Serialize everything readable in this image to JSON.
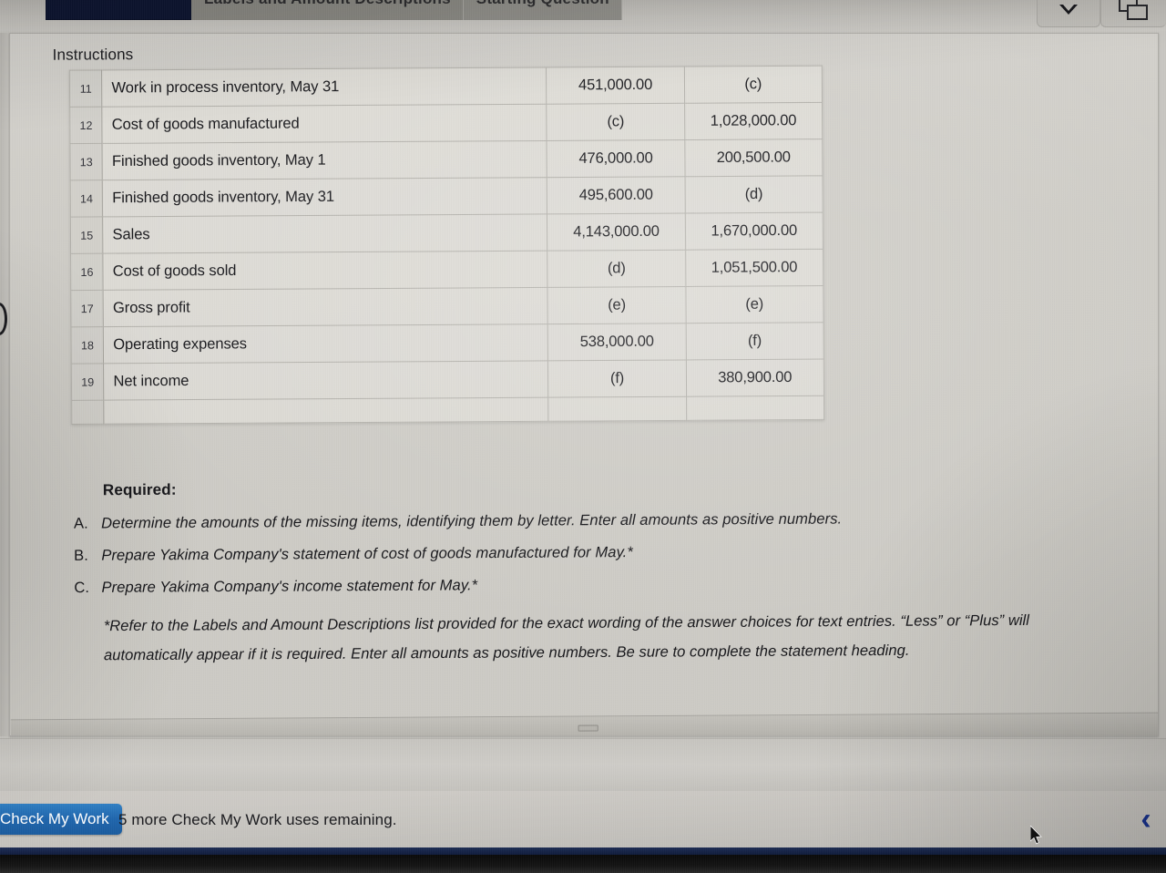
{
  "window": {
    "tabs": [
      {
        "label": "",
        "state": "active",
        "name": "tab-active-dark"
      },
      {
        "label": "Labels and Amount Descriptions",
        "state": "inactive",
        "name": "tab-labels-amount-descriptions"
      },
      {
        "label": "Starting Question",
        "state": "inactive",
        "name": "tab-starting-question"
      }
    ],
    "chrome_buttons": [
      {
        "icon": "chevron-down-icon",
        "label": ""
      },
      {
        "icon": "panes-icon",
        "label": ""
      }
    ]
  },
  "panel": {
    "section_label": "Instructions"
  },
  "sheet": {
    "rows": [
      {
        "num": "11",
        "label": "Work in process inventory, May 31",
        "col1": "451,000.00",
        "col2": "(c)"
      },
      {
        "num": "12",
        "label": "Cost of goods manufactured",
        "col1": "(c)",
        "col2": "1,028,000.00"
      },
      {
        "num": "13",
        "label": "Finished goods inventory, May 1",
        "col1": "476,000.00",
        "col2": "200,500.00"
      },
      {
        "num": "14",
        "label": "Finished goods inventory, May 31",
        "col1": "495,600.00",
        "col2": "(d)"
      },
      {
        "num": "15",
        "label": "Sales",
        "col1": "4,143,000.00",
        "col2": "1,670,000.00"
      },
      {
        "num": "16",
        "label": "Cost of goods sold",
        "col1": "(d)",
        "col2": "1,051,500.00"
      },
      {
        "num": "17",
        "label": "Gross profit",
        "col1": "(e)",
        "col2": "(e)"
      },
      {
        "num": "18",
        "label": "Operating expenses",
        "col1": "538,000.00",
        "col2": "(f)"
      },
      {
        "num": "19",
        "label": "Net income",
        "col1": "(f)",
        "col2": "380,900.00"
      }
    ]
  },
  "required": {
    "title": "Required:",
    "items": [
      {
        "letter": "A.",
        "text": "Determine the amounts of the missing items, identifying them by letter. Enter all amounts as positive numbers."
      },
      {
        "letter": "B.",
        "text": "Prepare Yakima Company's statement of cost of goods manufactured for May.*"
      },
      {
        "letter": "C.",
        "text": "Prepare Yakima Company's income statement for May.*"
      }
    ],
    "footnote": "*Refer to the Labels and Amount Descriptions list provided for the exact wording of the answer choices for text entries. “Less” or “Plus” will automatically appear if it is required. Enter all amounts as positive numbers. Be sure to complete the statement heading."
  },
  "footer": {
    "check_my_work_label": "Check My Work",
    "uses_remaining_text": "5 more Check My Work uses remaining.",
    "prev_glyph": "‹"
  },
  "colors": {
    "accent_blue": "#1f66ae",
    "nav_blue": "#15308f",
    "tab_active": "#0c1430",
    "page_bg": "#cfcdc8"
  }
}
